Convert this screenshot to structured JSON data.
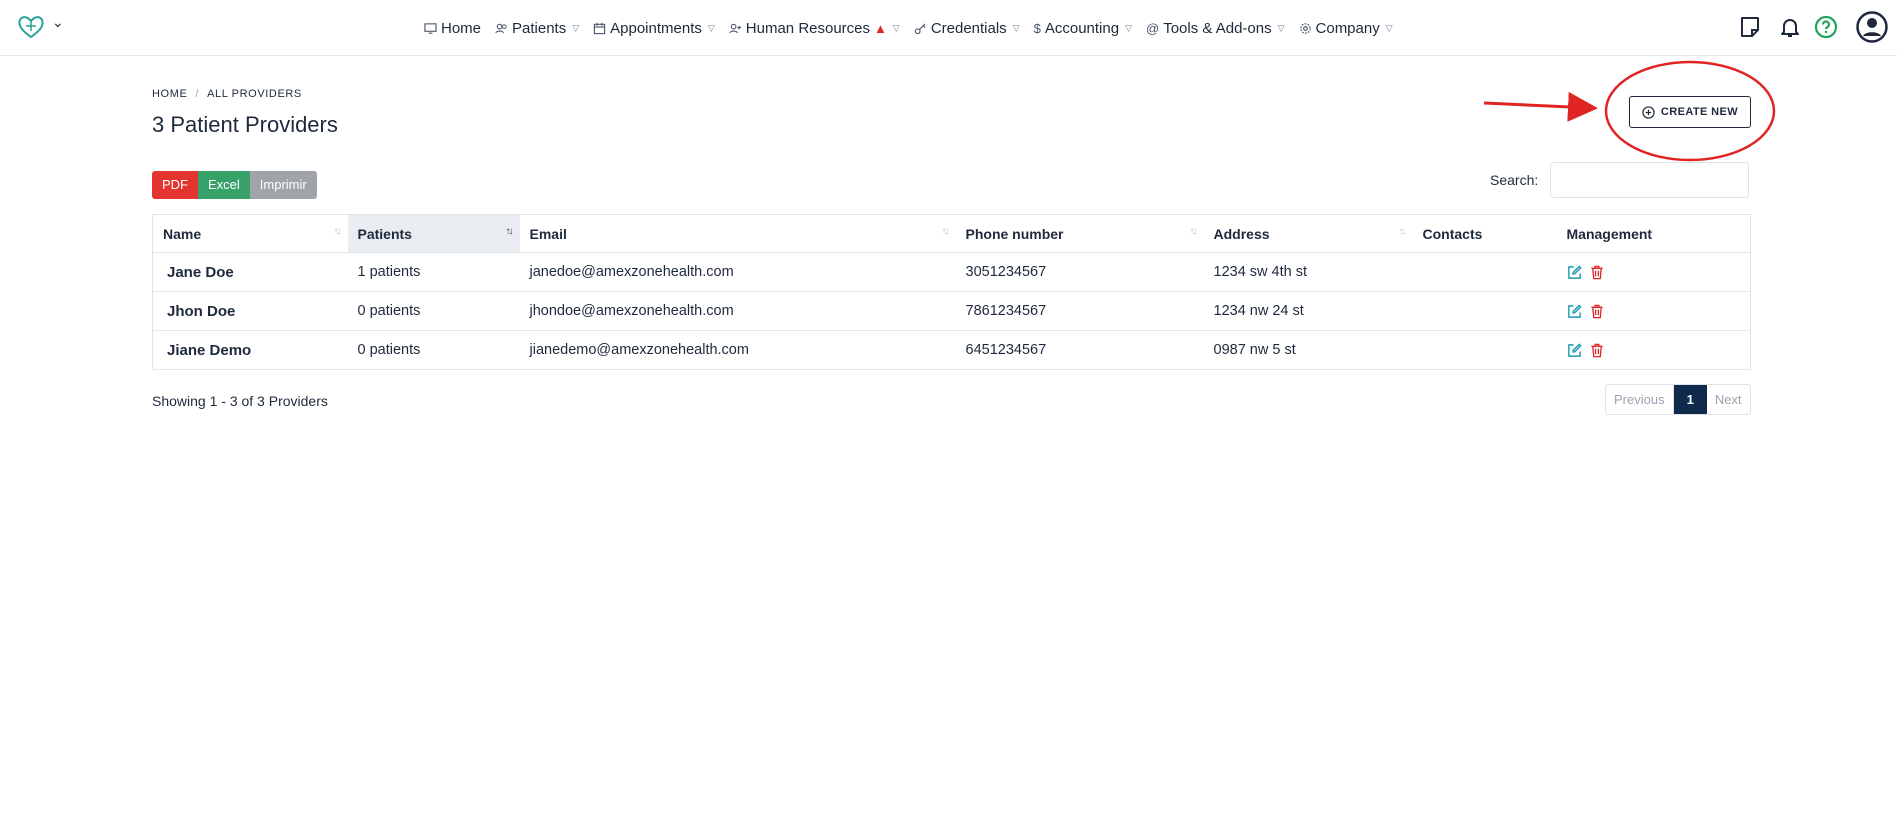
{
  "nav": {
    "items": [
      {
        "label": "Home",
        "dropdown": false
      },
      {
        "label": "Patients",
        "dropdown": true
      },
      {
        "label": "Appointments",
        "dropdown": true
      },
      {
        "label": "Human Resources",
        "dropdown": true,
        "warning": true
      },
      {
        "label": "Credentials",
        "dropdown": true
      },
      {
        "label": "Accounting",
        "dropdown": true
      },
      {
        "label": "Tools & Add-ons",
        "dropdown": true
      },
      {
        "label": "Company",
        "dropdown": true
      }
    ]
  },
  "breadcrumb": {
    "home": "HOME",
    "sep": "/",
    "current": "ALL PROVIDERS"
  },
  "page_title": "3 Patient Providers",
  "create_label": "CREATE NEW",
  "export": {
    "pdf": "PDF",
    "excel": "Excel",
    "print": "Imprimir"
  },
  "search": {
    "label": "Search:",
    "value": ""
  },
  "table": {
    "headers": {
      "name": "Name",
      "patients": "Patients",
      "email": "Email",
      "phone": "Phone number",
      "address": "Address",
      "contacts": "Contacts",
      "management": "Management"
    },
    "rows": [
      {
        "name": "Jane Doe",
        "patients": "1 patients",
        "email": "janedoe@amexzonehealth.com",
        "phone": "3051234567",
        "address": "1234 sw 4th st",
        "contacts": ""
      },
      {
        "name": "Jhon Doe",
        "patients": "0 patients",
        "email": "jhondoe@amexzonehealth.com",
        "phone": "7861234567",
        "address": "1234 nw 24 st",
        "contacts": ""
      },
      {
        "name": "Jiane Demo",
        "patients": "0 patients",
        "email": "jianedemo@amexzonehealth.com",
        "phone": "6451234567",
        "address": "0987 nw 5 st",
        "contacts": ""
      }
    ]
  },
  "footer": {
    "showing": "Showing 1 - 3 of 3 Providers"
  },
  "pagination": {
    "previous": "Previous",
    "current": "1",
    "next": "Next"
  },
  "colors": {
    "pdf": "#e3342f",
    "excel": "#38a169",
    "print": "#a0a4a8",
    "link": "#1a9bb0",
    "annotation": "#e02424",
    "page_active": "#0f2a4a"
  }
}
